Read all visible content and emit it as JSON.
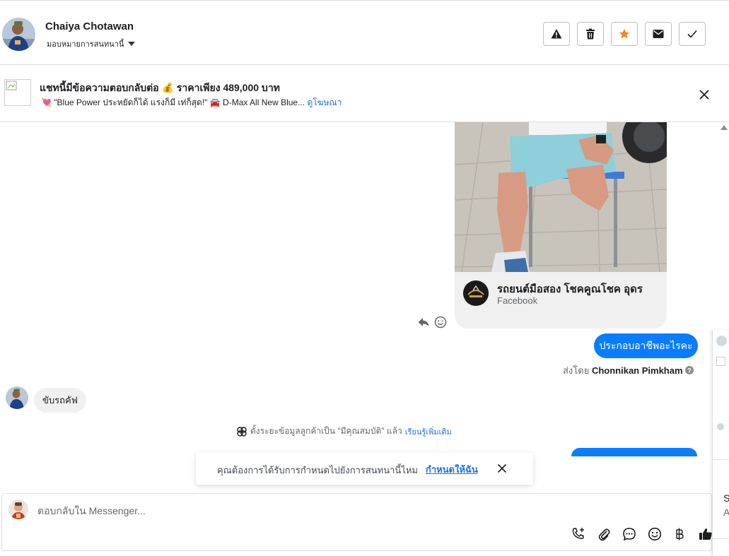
{
  "header": {
    "contact_name": "Chaiya Chotawan",
    "assign_label": "มอบหมายการสนทนานี้",
    "actions": [
      "warning-icon",
      "trash-icon",
      "star-icon",
      "envelope-icon",
      "check-icon"
    ],
    "star_color": "#f2861f"
  },
  "ad": {
    "title": "แชทนี้มีข้อความตอบกลับต่อ 💰 ราคาเพียง 489,000 บาท",
    "subtitle": "💘 \"Blue Power ประหยัดก็ได้ แรงก็มี เท่ก็สุด!\" 🚘 D-Max All New Blue...",
    "link": "ดูโฆษณา"
  },
  "chat": {
    "card": {
      "page_name": "รถยนต์มือสอง โชคคูณโชค อุดร",
      "source": "Facebook"
    },
    "outgoing_message": "ประกอบอาชีพอะไรคะ",
    "sent_by_label": "ส่งโดย",
    "sent_by_name": "Chonnikan Pimkham",
    "incoming_message": "ขับรถคัฟ",
    "system_message": "ตั้งระยะข้อมูลลูกค้าเป็น \"มีคุณสมบัติ\" แล้ว",
    "system_link": "เรียนรู้เพิ่มเติม",
    "accent_color": "#0a7cff"
  },
  "toast": {
    "text": "คุณต้องการได้รับการกำหนดไปยังการสนทนานี้ไหม",
    "link": "กำหนดให้ฉัน"
  },
  "composer": {
    "placeholder": "ตอบกลับใน Messenger...",
    "tools": [
      "phone-plus-icon",
      "attachment-icon",
      "saved-reply-icon",
      "emoji-icon",
      "baht-icon",
      "thumbs-up-icon"
    ]
  },
  "side_panel": {
    "letters": [
      "S",
      "A"
    ]
  }
}
